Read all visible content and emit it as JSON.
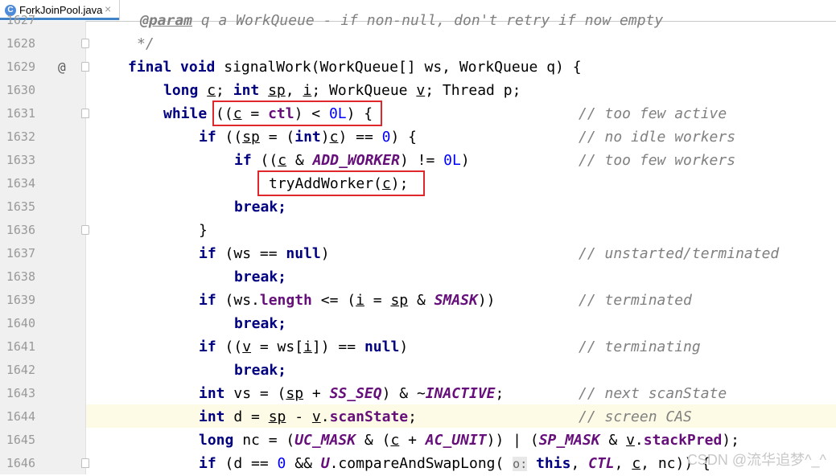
{
  "tab": {
    "label": "ForkJoinPool.java",
    "icon": "java-class-icon",
    "icon_glyph": "C",
    "close": "×"
  },
  "lines": [
    {
      "num": "1627",
      "pre": "",
      "code": "    @param q a WorkQueue - if non-null, don't retry if now empty",
      "fold": false
    },
    {
      "num": "1628",
      "code": "     */"
    },
    {
      "num": "1629",
      "annotation": "@",
      "code": "    final void signalWork(WorkQueue[] ws, WorkQueue q) {"
    },
    {
      "num": "1630",
      "code": "        long c; int sp, i; WorkQueue v; Thread p;"
    },
    {
      "num": "1631",
      "code": "        while ((c = ctl) < 0L) {"
    },
    {
      "num": "1632",
      "code": "            if ((sp = (int)c) == 0) {"
    },
    {
      "num": "1633",
      "code": "                if ((c & ADD_WORKER) != 0L)"
    },
    {
      "num": "1634",
      "code": "                    tryAddWorker(c);"
    },
    {
      "num": "1635",
      "code": "                break;"
    },
    {
      "num": "1636",
      "code": "            }"
    },
    {
      "num": "1637",
      "code": "            if (ws == null)"
    },
    {
      "num": "1638",
      "code": "                break;"
    },
    {
      "num": "1639",
      "code": "            if (ws.length <= (i = sp & SMASK))"
    },
    {
      "num": "1640",
      "code": "                break;"
    },
    {
      "num": "1641",
      "code": "            if ((v = ws[i]) == null)"
    },
    {
      "num": "1642",
      "code": "                break;"
    },
    {
      "num": "1643",
      "code": "            int vs = (sp + SS_SEQ) & ~INACTIVE;"
    },
    {
      "num": "1644",
      "code": "            int d = sp - v.scanState;"
    },
    {
      "num": "1645",
      "code": "            long nc = (UC_MASK & (c + AC_UNIT)) | (SP_MASK & v.stackPred);"
    },
    {
      "num": "1646",
      "code": "            if (d == 0 && U.compareAndSwapLong( o: this, CTL, c, nc)) {"
    }
  ],
  "tokens": {
    "final": "final",
    "void": "void",
    "signalWork": "signalWork(WorkQueue[] ws, WorkQueue q) {",
    "long": "long",
    "int": "int",
    "while": "while",
    "if": "if",
    "break": "break;",
    "null": "null",
    "c_too_few_active": "// too few active",
    "c_no_idle": "// no idle workers",
    "c_too_few_workers": "// too few workers",
    "c_unstarted": "// unstarted/terminated",
    "c_terminated": "// terminated",
    "c_terminating": "// terminating",
    "c_next_scan": "// next scanState",
    "c_screen_cas": "// screen CAS",
    "hint_o": "o:",
    "doc_tag": "@param",
    "doc_text": " q a WorkQueue - if non-null, don't retry if now empty",
    "doc_end": "*/"
  },
  "watermark": "CSDN @流华追梦^_^",
  "colors": {
    "keyword": "#000080",
    "number": "#0000ff",
    "comment": "#808080",
    "field": "#660e7a",
    "highlight": "#e0282c",
    "current_line": "#fdfbe5"
  }
}
